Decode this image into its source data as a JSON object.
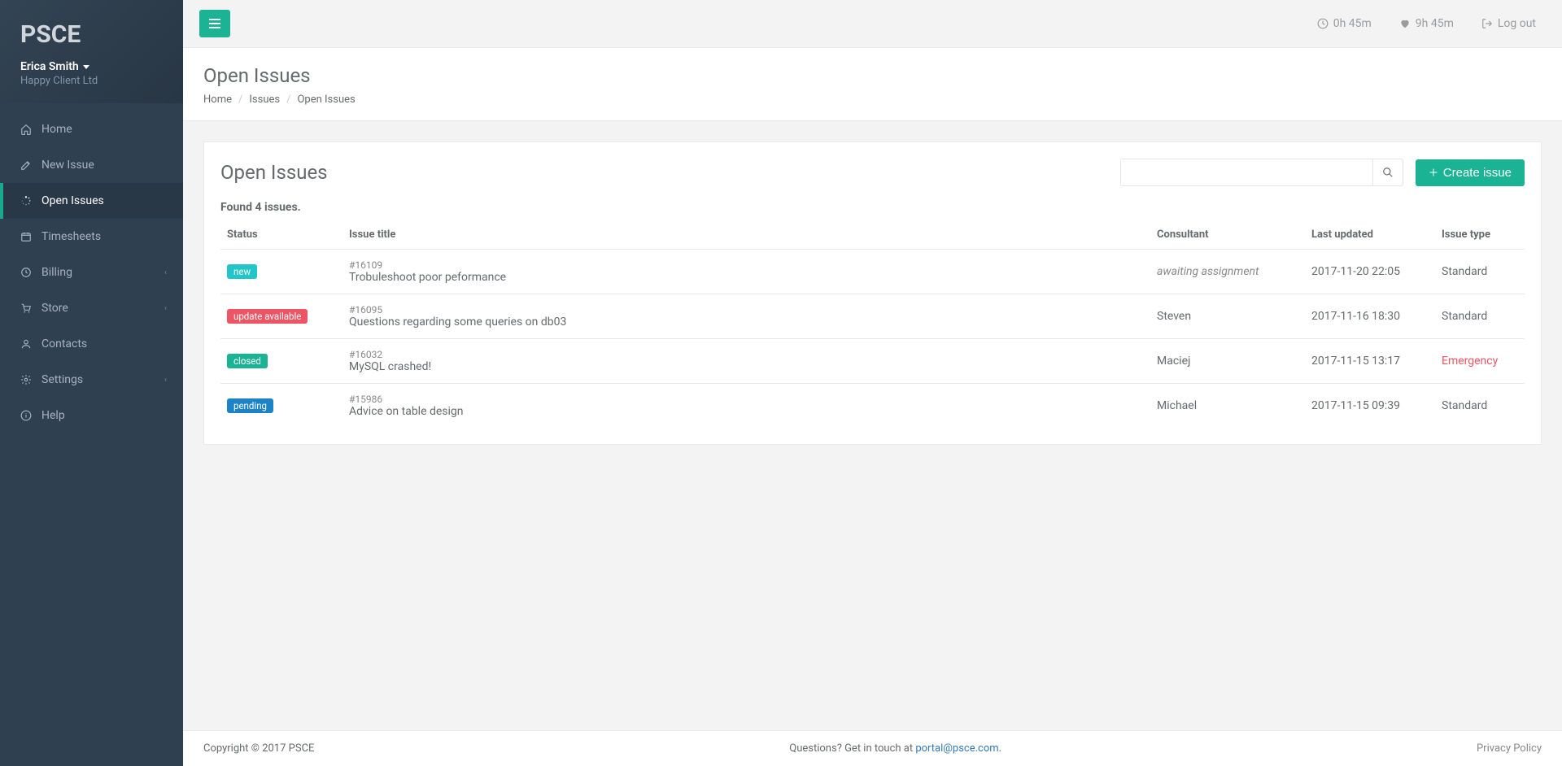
{
  "brand": "PSCE",
  "user": {
    "name": "Erica Smith",
    "org": "Happy Client Ltd"
  },
  "nav": [
    {
      "label": "Home",
      "icon": "home"
    },
    {
      "label": "New Issue",
      "icon": "edit"
    },
    {
      "label": "Open Issues",
      "icon": "spinner",
      "active": true
    },
    {
      "label": "Timesheets",
      "icon": "calendar"
    },
    {
      "label": "Billing",
      "icon": "clock",
      "expandable": true
    },
    {
      "label": "Store",
      "icon": "cart",
      "expandable": true
    },
    {
      "label": "Contacts",
      "icon": "user"
    },
    {
      "label": "Settings",
      "icon": "gear",
      "expandable": true
    },
    {
      "label": "Help",
      "icon": "info"
    }
  ],
  "topbar": {
    "time1": "0h 45m",
    "time2": "9h 45m",
    "logout": "Log out"
  },
  "page": {
    "title": "Open Issues",
    "breadcrumb": [
      "Home",
      "Issues",
      "Open Issues"
    ]
  },
  "panel": {
    "title": "Open Issues",
    "search_placeholder": "",
    "create_label": "Create issue",
    "found_text": "Found 4 issues.",
    "columns": [
      "Status",
      "Issue title",
      "Consultant",
      "Last updated",
      "Issue type"
    ],
    "rows": [
      {
        "status": "new",
        "status_class": "badge-new",
        "id": "#16109",
        "title": "Trobuleshoot poor peformance",
        "consultant": "awaiting assignment",
        "consultant_await": true,
        "updated": "2017-11-20 22:05",
        "type": "Standard"
      },
      {
        "status": "update available",
        "status_class": "badge-update",
        "id": "#16095",
        "title": "Questions regarding some queries on db03",
        "consultant": "Steven",
        "updated": "2017-11-16 18:30",
        "type": "Standard"
      },
      {
        "status": "closed",
        "status_class": "badge-closed",
        "id": "#16032",
        "title": "MySQL crashed!",
        "consultant": "Maciej",
        "updated": "2017-11-15 13:17",
        "type": "Emergency",
        "type_emergency": true
      },
      {
        "status": "pending",
        "status_class": "badge-pending",
        "id": "#15986",
        "title": "Advice on table design",
        "consultant": "Michael",
        "updated": "2017-11-15 09:39",
        "type": "Standard"
      }
    ]
  },
  "footer": {
    "copyright": "Copyright © 2017 PSCE",
    "question_prefix": "Questions? Get in touch at ",
    "email": "portal@psce.com",
    "privacy": "Privacy Policy"
  }
}
